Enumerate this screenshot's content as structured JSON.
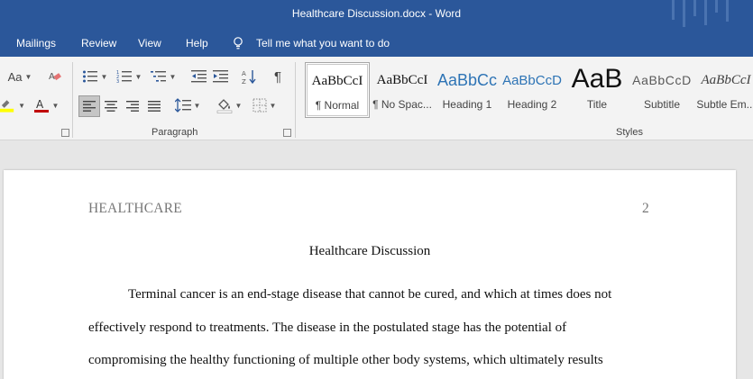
{
  "window": {
    "title": "Healthcare Discussion.docx  -  Word"
  },
  "menu": {
    "items": [
      "Mailings",
      "Review",
      "View",
      "Help"
    ],
    "tell_me": "Tell me what you want to do"
  },
  "ribbon": {
    "font_case_label": "Aa",
    "paragraph_group_label": "Paragraph",
    "styles_group_label": "Styles",
    "styles": [
      {
        "preview": "AaBbCcI",
        "name": "¶ Normal"
      },
      {
        "preview": "AaBbCcI",
        "name": "¶ No Spac..."
      },
      {
        "preview": "AaBbCc",
        "name": "Heading 1"
      },
      {
        "preview": "AaBbCcD",
        "name": "Heading 2"
      },
      {
        "preview": "AaB",
        "name": "Title"
      },
      {
        "preview": "AaBbCcD",
        "name": "Subtitle"
      },
      {
        "preview": "AaBbCcI",
        "name": "Subtle Em..."
      }
    ],
    "colors": {
      "highlight": "#ffff00",
      "font_color": "#c00000",
      "heading_blue": "#2e74b5"
    }
  },
  "document": {
    "running_head": "HEALTHCARE",
    "page_number": "2",
    "title": "Healthcare Discussion",
    "lines": [
      "Terminal cancer is an end-stage disease that cannot be cured, and which at times does not",
      "effectively respond to treatments. The disease in the postulated stage has the potential of",
      "compromising the healthy functioning of multiple other body systems, which ultimately results"
    ]
  },
  "theme": {
    "titlebar_bg": "#2b579a",
    "ribbon_bg": "#f3f3f3"
  }
}
